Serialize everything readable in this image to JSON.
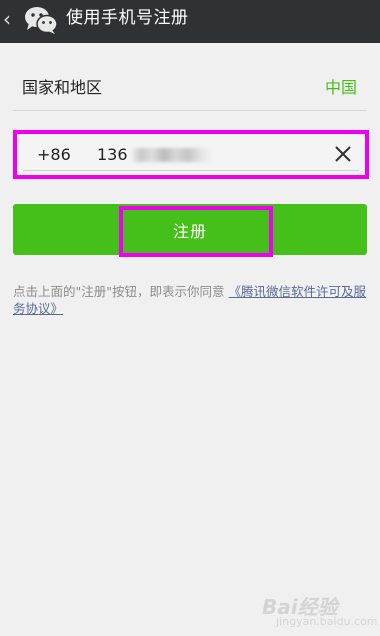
{
  "header": {
    "title": "使用手机号注册"
  },
  "country": {
    "label": "国家和地区",
    "value": "中国"
  },
  "phone": {
    "country_code": "+86",
    "visible_prefix": "136"
  },
  "register": {
    "label": "注册"
  },
  "agreement": {
    "text": "点击上面的\"注册\"按钮，即表示你同意",
    "link": "《腾讯微信软件许可及服务协议》"
  },
  "watermark": {
    "brand": "Bai经验",
    "site": "jingyan.baidu.com"
  },
  "colors": {
    "accent_green": "#45c01a",
    "header_bg": "#2f3133",
    "highlight": "#ee00ee",
    "link": "#576b95"
  },
  "icons": {
    "back": "chevron-left-icon",
    "logo": "wechat-logo-icon",
    "clear": "close-icon"
  }
}
